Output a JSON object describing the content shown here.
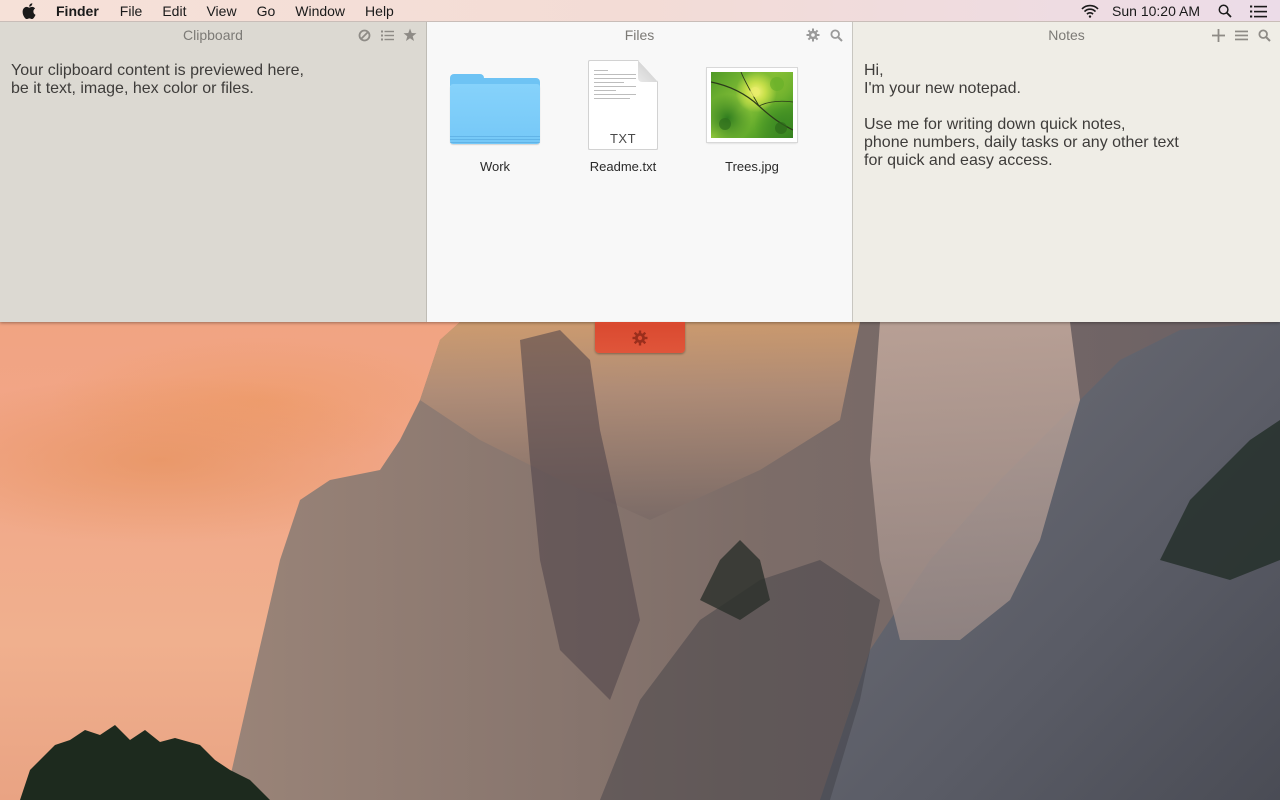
{
  "menubar": {
    "apple_icon": "apple-logo-icon",
    "app_name": "Finder",
    "menus": [
      "File",
      "Edit",
      "View",
      "Go",
      "Window",
      "Help"
    ],
    "status": {
      "wifi_icon": "wifi-icon",
      "clock": "Sun 10:20 AM",
      "spotlight_icon": "search-icon",
      "notification_icon": "notification-center-icon"
    }
  },
  "panes": {
    "clipboard": {
      "title": "Clipboard",
      "actions": [
        "clear-icon",
        "list-icon",
        "star-icon"
      ],
      "placeholder_text": "Your clipboard content is previewed here,\nbe it text, image, hex color or files."
    },
    "files": {
      "title": "Files",
      "actions": [
        "gear-icon",
        "search-icon"
      ],
      "items": [
        {
          "name": "Work",
          "type": "folder"
        },
        {
          "name": "Readme.txt",
          "type": "text",
          "badge": "TXT"
        },
        {
          "name": "Trees.jpg",
          "type": "image"
        }
      ]
    },
    "notes": {
      "title": "Notes",
      "actions": [
        "plus-icon",
        "menu-icon",
        "search-icon"
      ],
      "content": "Hi,\nI'm your new notepad.\n\nUse me for writing down quick notes,\nphone numbers, daily tasks or any other text\nfor quick and easy access."
    }
  },
  "handle": {
    "icon": "gear-icon",
    "color": "#dc4d33"
  },
  "colors": {
    "clipboard_bg": "#dcd9d2",
    "files_bg": "#f8f8f8",
    "notes_bg": "#efede6",
    "folder_blue": "#7ccdf8"
  }
}
